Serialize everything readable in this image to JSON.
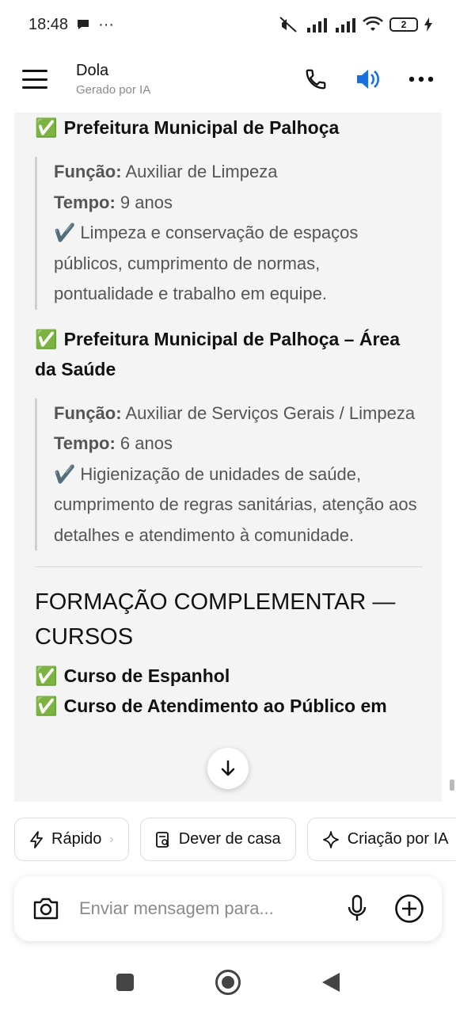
{
  "status": {
    "time": "18:48",
    "dots": "···",
    "battery": "2"
  },
  "header": {
    "title": "Dola",
    "subtitle": "Gerado por IA"
  },
  "content": {
    "job1": {
      "heading": "Prefeitura Municipal de Palhoça",
      "func_label": "Função:",
      "func_value": " Auxiliar de Limpeza",
      "time_label": "Tempo:",
      "time_value": " 9 anos",
      "desc": "Limpeza e conservação de espaços públicos, cumprimento de normas, pontualidade e trabalho em equipe."
    },
    "job2": {
      "heading": "Prefeitura Municipal de Palhoça – Área da Saúde",
      "func_label": "Função:",
      "func_value": " Auxiliar de Serviços Gerais / Limpeza",
      "time_label": "Tempo:",
      "time_value": " 6 anos",
      "desc": "Higienização de unidades de saúde, cumprimento de regras sanitárias, atenção aos detalhes e atendimento à comunidade."
    },
    "section_title": "FORMAÇÃO COMPLEMENTAR — CURSOS",
    "course1": "Curso de Espanhol",
    "course2": "Curso de Atendimento ao Público em"
  },
  "chips": [
    {
      "label": "Rápido"
    },
    {
      "label": "Dever de casa"
    },
    {
      "label": "Criação por IA"
    }
  ],
  "input": {
    "placeholder": "Enviar mensagem para..."
  }
}
